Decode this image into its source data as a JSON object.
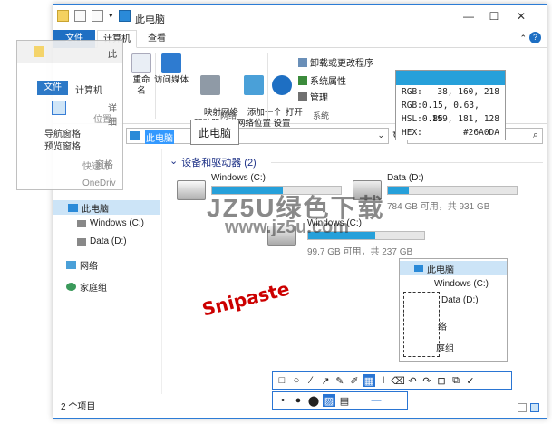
{
  "window": {
    "title": "此电脑",
    "minimize": "—",
    "maximize": "☐",
    "close": "✕"
  },
  "tabs": {
    "file": "文件",
    "computer": "计算机",
    "view": "查看"
  },
  "ribbon": {
    "groups": {
      "network": "网络",
      "system": "系统"
    },
    "buttons": {
      "media": "访问媒体",
      "map_drive": "映射网络\n驱动器 ▾",
      "add_location": "添加一个\n网络位置",
      "open_settings": "打开\n设置",
      "uninstall": "卸载或更改程序",
      "sys_props": "系统属性",
      "manage": "管理"
    }
  },
  "address": {
    "path": "此电脑",
    "search_icon": "search-icon"
  },
  "tooltip": "此电脑",
  "color_picker": {
    "swatch": "#26A0DA",
    "rows": [
      {
        "label": "RGB:",
        "value": "38,  160,  218"
      },
      {
        "label": "RGB:",
        "value": "0.15, 0.63, 0.85"
      },
      {
        "label": "HSL:",
        "value": "199,  181,  128"
      },
      {
        "label": "HEX:",
        "value": "#26A0DA"
      }
    ]
  },
  "section_header": "设备和驱动器 (2)",
  "drives": [
    {
      "name": "Windows (C:)",
      "usage": 0.55
    },
    {
      "name": "Data (D:)",
      "info": "784 GB 可用，共 931 GB",
      "usage": 0.16
    }
  ],
  "drive_copy": {
    "name": "Windows (C:)",
    "info": "99.7 GB 可用，共 237 GB",
    "usage": 0.58
  },
  "nav": [
    {
      "label": "此电脑"
    },
    {
      "label": "Windows (C:)"
    },
    {
      "label": "Data (D:)"
    },
    {
      "label": "网络"
    },
    {
      "label": "家庭组"
    }
  ],
  "overlay_panel": {
    "file_tab": "文件",
    "computer_tab": "计算机",
    "breadcrumb": "此",
    "pane_label": "导航窗格",
    "preview_label": "预览窗格",
    "view_details": "详细",
    "layout": "位置",
    "quick_access": "快速访",
    "onedrive": "OneDriv",
    "sub": "窗格"
  },
  "partial_labels": {
    "rename": "重命名",
    "checkbox": "查看"
  },
  "mini_tree": [
    {
      "label": "此电脑"
    },
    {
      "label": "Windows (C:)"
    },
    {
      "label": "Data (D:)"
    },
    {
      "label": "络"
    },
    {
      "label": "庭组"
    }
  ],
  "status": "2 个项目",
  "snipaste_label": "Snipaste",
  "watermark": {
    "line1": "JZ5U绿色下载",
    "line2": "www.jz5u.com"
  },
  "toolbar": [
    "□",
    "○",
    "⁄",
    "↗",
    "✎",
    "✐",
    "▦",
    "I",
    "⌫",
    "↶",
    "↷",
    "⊟",
    "⧉",
    "✓"
  ],
  "toolbar2": [
    "•",
    "●",
    "⬤",
    "▨",
    "▤",
    "—"
  ]
}
